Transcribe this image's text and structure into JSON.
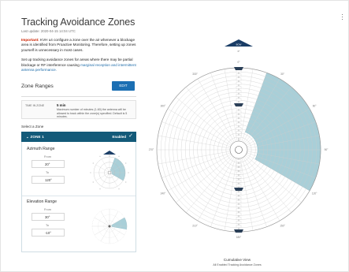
{
  "header": {
    "title": "Tracking Avoidance Zones",
    "last_update": "Last update: 2020-04-15 14:04 UTC"
  },
  "important": {
    "label": "Important:",
    "text": "KVH u4 configure a zone over the air whenever a blockage area is identified from Proactive Monitoring. Therefore, setting up zones yourself is unnecessary in most cases."
  },
  "setup": {
    "text": "Set up tracking avoidance zones for areas where there may be partial blockage or RF interference causing ",
    "link": "marginal reception and intermittent antenna performance."
  },
  "zone_ranges": {
    "heading": "Zone Ranges",
    "edit_label": "EDIT"
  },
  "time_in_zone": {
    "label": "TIME IN ZONE",
    "value": "5 min",
    "description": "Maximum number of minutes (1-60) the antenna will be allowed to track within the zone(s) specified. Default is 5 minutes."
  },
  "select_zone": "Select a Zone",
  "zone": {
    "name": "ZONE 1",
    "status": "Enabled",
    "chevron": "chevron-down-icon",
    "check": "check-icon"
  },
  "azimuth": {
    "title": "Azimuth Range",
    "from_label": "From",
    "from_value": "20°",
    "to_label": "To",
    "to_value": "120°",
    "from_deg": 20,
    "to_deg": 120
  },
  "elevation": {
    "title": "Elevation Range",
    "from_label": "From",
    "from_value": "30°",
    "to_label": "To",
    "to_value": "-10°",
    "from_deg": 30,
    "to_deg": -10
  },
  "cumulative": {
    "title": "Cumulative View",
    "subtitle": "All Enabled Tracking Avoidance Zones",
    "zone_from_deg": 20,
    "zone_to_deg": 120,
    "outer_tick_labels": [
      "0°",
      "30°",
      "60°",
      "90°",
      "120°",
      "150°",
      "180°",
      "210°",
      "240°",
      "270°",
      "300°",
      "330°"
    ],
    "top_marker": "BOW",
    "stem_label": "0°"
  },
  "colors": {
    "accent": "#1c6fb3",
    "zone_header": "#135a79",
    "zone_fill": "#a9cfd8",
    "important": "#cc2200",
    "link": "#1b6aa8"
  }
}
